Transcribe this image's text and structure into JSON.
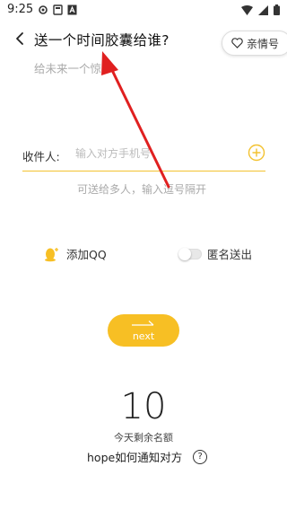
{
  "status_bar": {
    "time": "9:25",
    "left_icons": [
      "gear-icon",
      "notification-icon",
      "app-a-icon"
    ],
    "right_icons": [
      "wifi-icon",
      "signal-icon",
      "battery-icon"
    ]
  },
  "header": {
    "title": "送一个时间胶囊给谁?",
    "kin_button_label": "亲情号"
  },
  "message": {
    "placeholder": "给未来一个惊"
  },
  "recipient": {
    "label": "收件人:",
    "placeholder": "输入对方手机号",
    "hint": "可送给多人，输入逗号隔开"
  },
  "options": {
    "add_qq_label": "添加QQ",
    "anonymous_label": "匿名送出",
    "anonymous_enabled": false
  },
  "next_button": {
    "label": "next"
  },
  "quota": {
    "number": "10",
    "label": "今天剩余名额",
    "notify_text": "hope如何通知对方",
    "help_symbol": "?"
  },
  "colors": {
    "accent": "#f7bf24",
    "underline": "#f3c230",
    "annotation": "#e02020"
  }
}
